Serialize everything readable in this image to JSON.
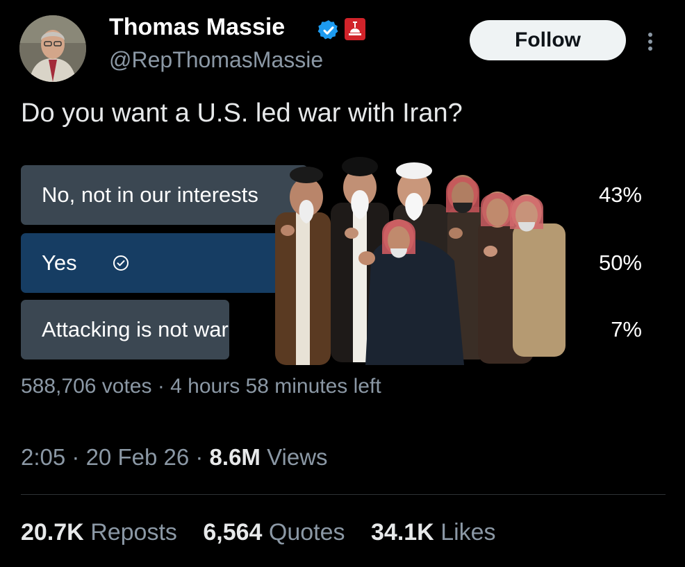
{
  "author": {
    "display_name": "Thomas Massie",
    "handle": "@RepThomasMassie",
    "follow_label": "Follow"
  },
  "icons": {
    "verified": "verified-badge-icon",
    "affiliation": "government-affiliation-icon",
    "more": "more-options-icon",
    "selected": "check-circle-icon"
  },
  "colors": {
    "background": "#000000",
    "poll_bar": "#3b4752",
    "poll_bar_selected": "#163d63",
    "verified_blue": "#1d9bf0",
    "affiliation_red": "#d1232a"
  },
  "question": "Do you want a U.S. led war with Iran?",
  "poll": {
    "options": [
      {
        "label": "No, not in our interests",
        "percent_text": "43%",
        "percent": 43,
        "selected": false
      },
      {
        "label": "Yes",
        "percent_text": "50%",
        "percent": 50,
        "selected": true
      },
      {
        "label": "Attacking is not war",
        "percent_text": "7%",
        "percent": 7,
        "selected": false
      }
    ],
    "votes": "588,706 votes",
    "time_left": "4 hours 58 minutes left"
  },
  "meta": {
    "time": "2:05",
    "date": "20 Feb 26",
    "views_count": "8.6M",
    "views_label": "Views"
  },
  "stats": {
    "reposts_count": "20.7K",
    "reposts_label": "Reposts",
    "quotes_count": "6,564",
    "quotes_label": "Quotes",
    "likes_count": "34.1K",
    "likes_label": "Likes"
  }
}
